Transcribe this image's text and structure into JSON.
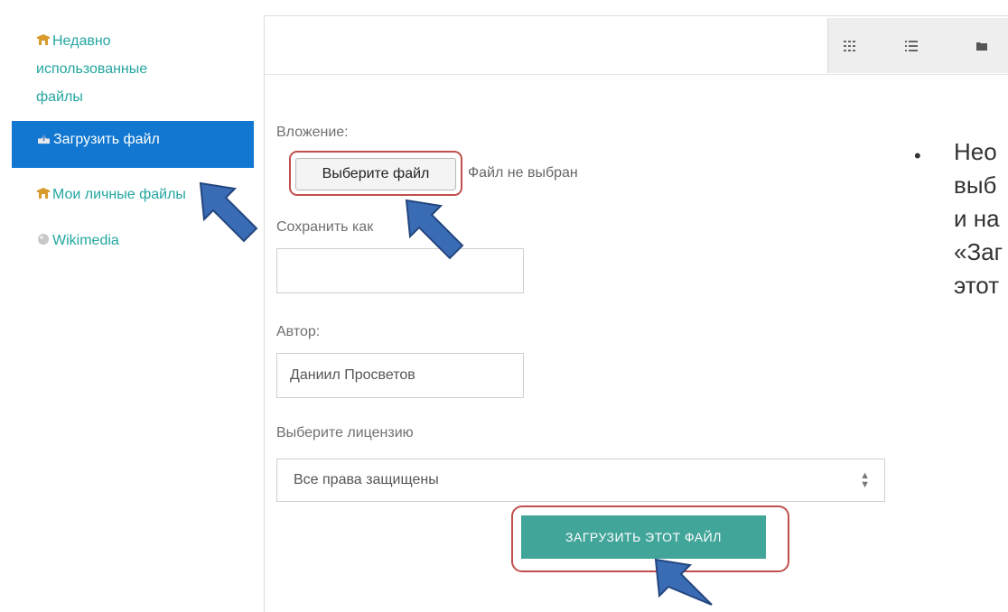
{
  "sidebar": {
    "items": [
      {
        "label_lines": [
          "Недавно",
          "использованные",
          "файлы"
        ],
        "icon": "folder-icon"
      },
      {
        "label": "Загрузить файл",
        "icon": "upload-icon",
        "active": true
      },
      {
        "label": "Мои личные файлы",
        "icon": "folder-icon"
      },
      {
        "label": "Wikimedia",
        "icon": "wikimedia-icon"
      }
    ]
  },
  "toolbar": {
    "views": [
      {
        "name": "icons-view",
        "icon": "grid-icon"
      },
      {
        "name": "list-view",
        "icon": "list-icon"
      },
      {
        "name": "tree-view",
        "icon": "folder-icon"
      }
    ]
  },
  "form": {
    "attachment_label": "Вложение:",
    "choose_file_label": "Выберите файл",
    "no_file_text": "Файл не выбран",
    "save_as_label": "Сохранить как",
    "save_as_value": "",
    "author_label": "Автор:",
    "author_value": "Даниил Просветов",
    "license_label": "Выберите лицензию",
    "license_value": "Все права защищены",
    "upload_button_label": "ЗАГРУЗИТЬ ЭТОТ ФАЙЛ"
  },
  "slide": {
    "bullet": "•",
    "lines": [
      "Нео",
      "выб",
      "и на",
      "«Заг",
      "этот"
    ]
  },
  "colors": {
    "accent_link": "#23a6a0",
    "active_item": "#1177d1",
    "upload_button": "#42a59a",
    "highlight": "#c0504d",
    "pointer_arrow": "#3a6bb5"
  }
}
